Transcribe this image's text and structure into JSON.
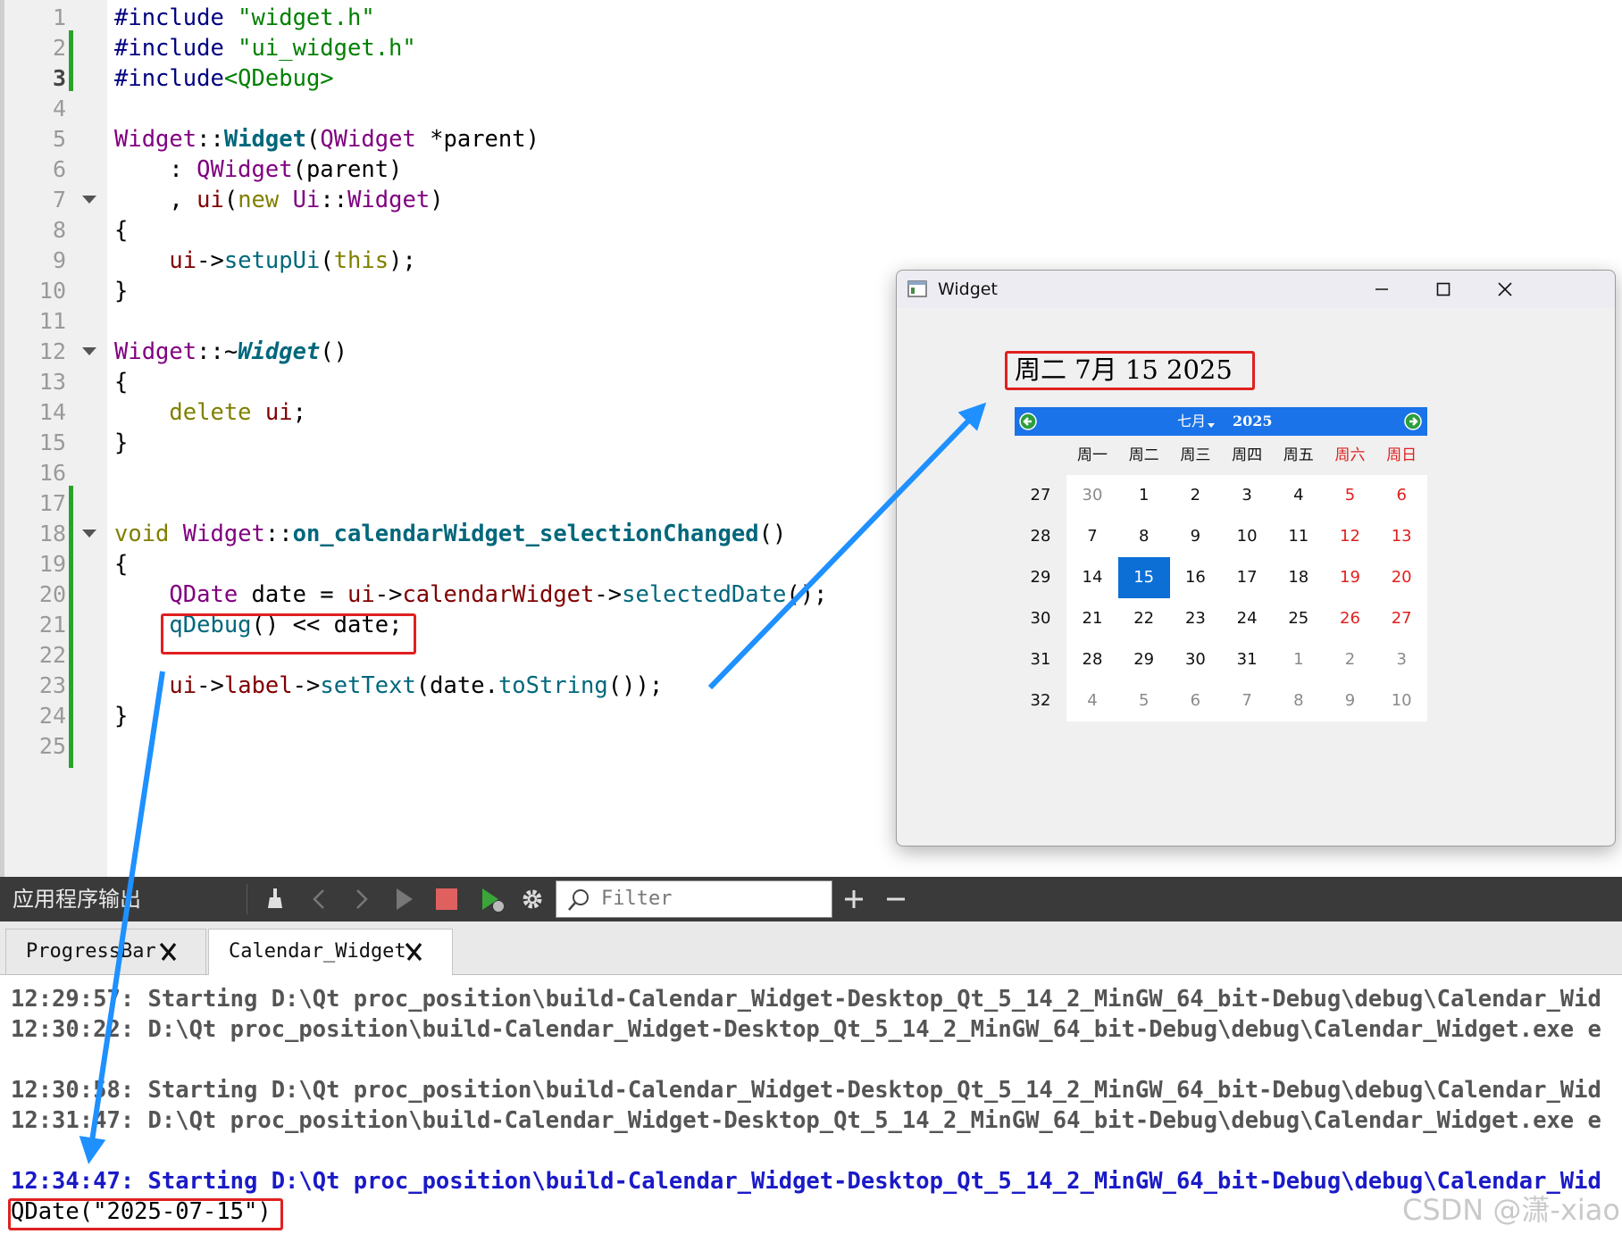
{
  "editor": {
    "line_numbers": [
      "1",
      "2",
      "3",
      "4",
      "5",
      "6",
      "7",
      "8",
      "9",
      "10",
      "11",
      "12",
      "13",
      "14",
      "15",
      "16",
      "17",
      "18",
      "19",
      "20",
      "21",
      "22",
      "23",
      "24",
      "25"
    ],
    "lines": [
      [
        {
          "t": "#include ",
          "c": "pp"
        },
        {
          "t": "\"widget.h\"",
          "c": "str"
        }
      ],
      [
        {
          "t": "#include ",
          "c": "pp"
        },
        {
          "t": "\"ui_widget.h\"",
          "c": "str"
        }
      ],
      [
        {
          "t": "#include",
          "c": "pp"
        },
        {
          "t": "<QDebug>",
          "c": "str"
        }
      ],
      [],
      [
        {
          "t": "Widget",
          "c": "ty"
        },
        {
          "t": "::",
          "c": ""
        },
        {
          "t": "Widget",
          "c": "fnb"
        },
        {
          "t": "(",
          "c": ""
        },
        {
          "t": "QWidget",
          "c": "ty"
        },
        {
          "t": " *parent)",
          "c": ""
        }
      ],
      [
        {
          "t": "    : ",
          "c": ""
        },
        {
          "t": "QWidget",
          "c": "ty"
        },
        {
          "t": "(parent)",
          "c": ""
        }
      ],
      [
        {
          "t": "    , ",
          "c": ""
        },
        {
          "t": "ui",
          "c": "var"
        },
        {
          "t": "(",
          "c": ""
        },
        {
          "t": "new",
          "c": "kw"
        },
        {
          "t": " ",
          "c": ""
        },
        {
          "t": "Ui",
          "c": "ty"
        },
        {
          "t": "::",
          "c": ""
        },
        {
          "t": "Widget",
          "c": "ty"
        },
        {
          "t": ")",
          "c": ""
        }
      ],
      [
        {
          "t": "{",
          "c": ""
        }
      ],
      [
        {
          "t": "    ",
          "c": ""
        },
        {
          "t": "ui",
          "c": "var"
        },
        {
          "t": "->",
          "c": ""
        },
        {
          "t": "setupUi",
          "c": "fn"
        },
        {
          "t": "(",
          "c": ""
        },
        {
          "t": "this",
          "c": "kw"
        },
        {
          "t": ");",
          "c": ""
        }
      ],
      [
        {
          "t": "}",
          "c": ""
        }
      ],
      [],
      [
        {
          "t": "Widget",
          "c": "ty"
        },
        {
          "t": "::~",
          "c": ""
        },
        {
          "t": "Widget",
          "c": "fni"
        },
        {
          "t": "()",
          "c": ""
        }
      ],
      [
        {
          "t": "{",
          "c": ""
        }
      ],
      [
        {
          "t": "    ",
          "c": ""
        },
        {
          "t": "delete",
          "c": "kw"
        },
        {
          "t": " ",
          "c": ""
        },
        {
          "t": "ui",
          "c": "var"
        },
        {
          "t": ";",
          "c": ""
        }
      ],
      [
        {
          "t": "}",
          "c": ""
        }
      ],
      [],
      [],
      [
        {
          "t": "void",
          "c": "kw"
        },
        {
          "t": " ",
          "c": ""
        },
        {
          "t": "Widget",
          "c": "ty"
        },
        {
          "t": "::",
          "c": ""
        },
        {
          "t": "on_calendarWidget_selectionChanged",
          "c": "fnb"
        },
        {
          "t": "()",
          "c": ""
        }
      ],
      [
        {
          "t": "{",
          "c": ""
        }
      ],
      [
        {
          "t": "    ",
          "c": ""
        },
        {
          "t": "QDate",
          "c": "ty"
        },
        {
          "t": " date = ",
          "c": ""
        },
        {
          "t": "ui",
          "c": "var"
        },
        {
          "t": "->",
          "c": ""
        },
        {
          "t": "calendarWidget",
          "c": "var"
        },
        {
          "t": "->",
          "c": ""
        },
        {
          "t": "selectedDate",
          "c": "fn"
        },
        {
          "t": "();",
          "c": ""
        }
      ],
      [
        {
          "t": "    ",
          "c": ""
        },
        {
          "t": "qDebug",
          "c": "fn"
        },
        {
          "t": "() << date;",
          "c": ""
        }
      ],
      [],
      [
        {
          "t": "    ",
          "c": ""
        },
        {
          "t": "ui",
          "c": "var"
        },
        {
          "t": "->",
          "c": ""
        },
        {
          "t": "label",
          "c": "var"
        },
        {
          "t": "->",
          "c": ""
        },
        {
          "t": "setText",
          "c": "fn"
        },
        {
          "t": "(date.",
          "c": ""
        },
        {
          "t": "toString",
          "c": "fn"
        },
        {
          "t": "());",
          "c": ""
        }
      ],
      [
        {
          "t": "}",
          "c": ""
        }
      ],
      []
    ]
  },
  "output": {
    "title": "应用程序输出",
    "filter_placeholder": "Filter",
    "tabs": [
      {
        "label": "ProgressBar"
      },
      {
        "label": "Calendar_Widget"
      }
    ],
    "log_lines": [
      "12:29:57: Starting D:\\Qt proc_position\\build-Calendar_Widget-Desktop_Qt_5_14_2_MinGW_64_bit-Debug\\debug\\Calendar_Wid",
      "12:30:22: D:\\Qt proc_position\\build-Calendar_Widget-Desktop_Qt_5_14_2_MinGW_64_bit-Debug\\debug\\Calendar_Widget.exe e",
      "12:30:58: Starting D:\\Qt proc_position\\build-Calendar_Widget-Desktop_Qt_5_14_2_MinGW_64_bit-Debug\\debug\\Calendar_Wid",
      "12:31:47: D:\\Qt proc_position\\build-Calendar_Widget-Desktop_Qt_5_14_2_MinGW_64_bit-Debug\\debug\\Calendar_Widget.exe e",
      "12:34:47: Starting D:\\Qt proc_position\\build-Calendar_Widget-Desktop_Qt_5_14_2_MinGW_64_bit-Debug\\debug\\Calendar_Wid"
    ],
    "debug_output": "QDate(\"2025-07-15\")"
  },
  "widget_window": {
    "title": "Widget",
    "date_label": "周二 7月 15 2025",
    "calendar": {
      "month": "七月",
      "year": "2025",
      "weekday_headers": [
        "周一",
        "周二",
        "周三",
        "周四",
        "周五",
        "周六",
        "周日"
      ],
      "week_numbers": [
        "27",
        "28",
        "29",
        "30",
        "31",
        "32"
      ],
      "rows": [
        [
          "30",
          "1",
          "2",
          "3",
          "4",
          "5",
          "6"
        ],
        [
          "7",
          "8",
          "9",
          "10",
          "11",
          "12",
          "13"
        ],
        [
          "14",
          "15",
          "16",
          "17",
          "18",
          "19",
          "20"
        ],
        [
          "21",
          "22",
          "23",
          "24",
          "25",
          "26",
          "27"
        ],
        [
          "28",
          "29",
          "30",
          "31",
          "1",
          "2",
          "3"
        ],
        [
          "4",
          "5",
          "6",
          "7",
          "8",
          "9",
          "10"
        ]
      ],
      "selected": "15"
    }
  },
  "watermark": "CSDN @潇-xiao",
  "colors": {
    "accent_blue": "#1a73e8",
    "highlight_red": "#e02020",
    "arrow_blue": "#1e90ff"
  }
}
